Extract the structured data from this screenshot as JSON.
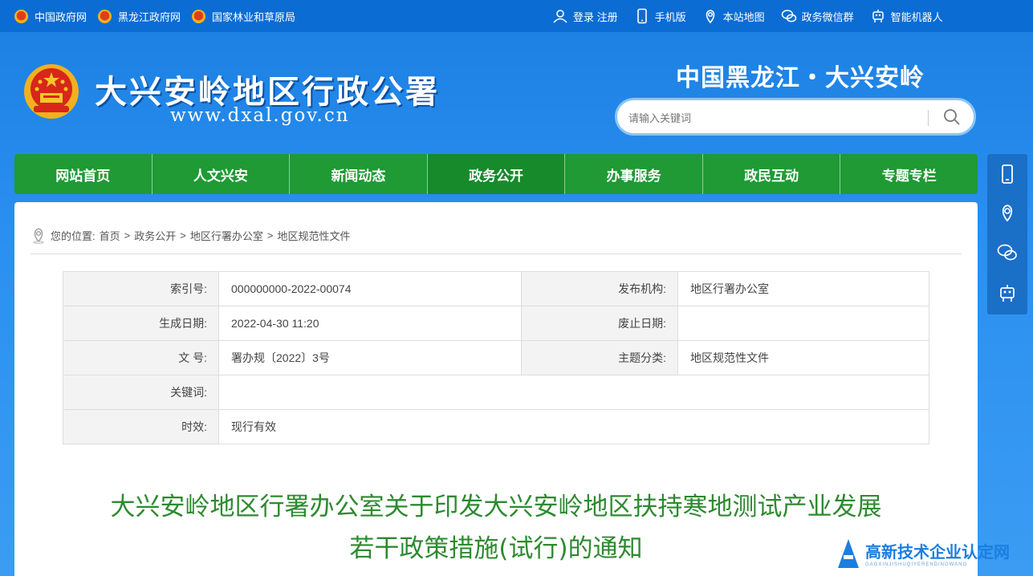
{
  "topbar": {
    "links_left": [
      {
        "label": "中国政府网"
      },
      {
        "label": "黑龙江政府网"
      },
      {
        "label": "国家林业和草原局"
      }
    ],
    "links_right": [
      {
        "label": "登录 注册",
        "icon": "user-icon"
      },
      {
        "label": "手机版",
        "icon": "mobile-icon"
      },
      {
        "label": "本站地图",
        "icon": "map-icon"
      },
      {
        "label": "政务微信群",
        "icon": "wechat-icon"
      },
      {
        "label": "智能机器人",
        "icon": "robot-icon"
      }
    ]
  },
  "header": {
    "title": "大兴安岭地区行政公署",
    "url": "www.dxal.gov.cn",
    "region": "中国黑龙江・大兴安岭"
  },
  "search": {
    "placeholder": "请输入关键词"
  },
  "nav": {
    "items": [
      {
        "label": "网站首页"
      },
      {
        "label": "人文兴安"
      },
      {
        "label": "新闻动态"
      },
      {
        "label": "政务公开",
        "active": true
      },
      {
        "label": "办事服务"
      },
      {
        "label": "政民互动"
      },
      {
        "label": "专题专栏"
      }
    ]
  },
  "breadcrumb": {
    "prefix": "您的位置:",
    "items": [
      "首页",
      "政务公开",
      "地区行署办公室",
      "地区规范性文件"
    ],
    "separator": ">"
  },
  "meta": {
    "index_label": "索引号:",
    "index_value": "000000000-2022-00074",
    "publisher_label": "发布机构:",
    "publisher_value": "地区行署办公室",
    "created_label": "生成日期:",
    "created_value": "2022-04-30 11:20",
    "abolish_label": "废止日期:",
    "abolish_value": "",
    "doc_label": "文 号:",
    "doc_value": "署办规〔2022〕3号",
    "topic_label": "主题分类:",
    "topic_value": "地区规范性文件",
    "keyword_label": "关键词:",
    "keyword_value": "",
    "validity_label": "时效:",
    "validity_value": "现行有效"
  },
  "article": {
    "title_line1": "大兴安岭地区行署办公室关于印发大兴安岭地区扶持寒地测试产业发展",
    "title_line2": "若干政策措施(试行)的通知"
  },
  "watermark": {
    "text": "高新技术企业认定网",
    "sub": "GAOXINJISHUQIYERENDINGWANG"
  },
  "colors": {
    "nav_green": "#1f9a35",
    "title_green": "#2d8a2f",
    "bg_blue": "#1a7fe0"
  }
}
